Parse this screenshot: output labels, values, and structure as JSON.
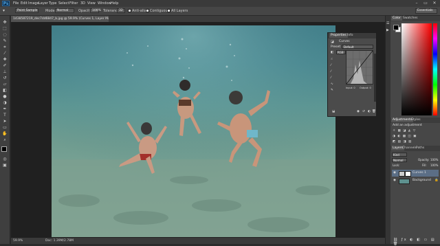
{
  "menu": {
    "logo": "Ps",
    "items": [
      "File",
      "Edit",
      "Image",
      "Layer",
      "Type",
      "Select",
      "Filter",
      "3D",
      "View",
      "Window",
      "Help"
    ]
  },
  "window_controls": [
    "–",
    "▭",
    "✕"
  ],
  "options": {
    "sample_label": "Point Sample",
    "mode_label": "Mode:",
    "mode_value": "Normal",
    "opacity_label": "Opacity:",
    "opacity_value": "100%",
    "tolerance_label": "Tolerance:",
    "tolerance_value": "32",
    "anti_alias": "Anti-alias",
    "contiguous": "Contiguous",
    "all_layers": "All Layers",
    "workspace": "Essentials"
  },
  "document": {
    "tab_title": "1438587219_dec7dd6847_b.jpg @ 59.9% (Curves 1, Layer Mask/8) *",
    "zoom": "59.9%",
    "doc_info": "Doc: 1.39M/2.78M"
  },
  "properties": {
    "tab_properties": "Properties",
    "tab_info": "Info",
    "title": "Curves",
    "preset_label": "Preset:",
    "preset_value": "Default",
    "channel_value": "RGB",
    "auto_label": "Auto",
    "input_label": "Input: 0",
    "output_label": "Output: 0"
  },
  "color_panel": {
    "tab_color": "Color",
    "tab_swatches": "Swatches"
  },
  "adjustments": {
    "tab_adjustments": "Adjustments",
    "tab_styles": "Styles",
    "heading": "Add an adjustment"
  },
  "layers": {
    "tab_layers": "Layers",
    "tab_channels": "Channels",
    "tab_paths": "Paths",
    "kind_label": "Kind",
    "blend_mode": "Normal",
    "opacity_label": "Opacity:",
    "opacity_value": "100%",
    "lock_label": "Lock:",
    "fill_label": "Fill:",
    "fill_value": "100%",
    "items": [
      {
        "name": "Curves 1"
      },
      {
        "name": "Background"
      }
    ]
  },
  "colors": {
    "accent": "#2e6da4",
    "panel_bg": "#474747",
    "canvas_bg": "#202020"
  }
}
